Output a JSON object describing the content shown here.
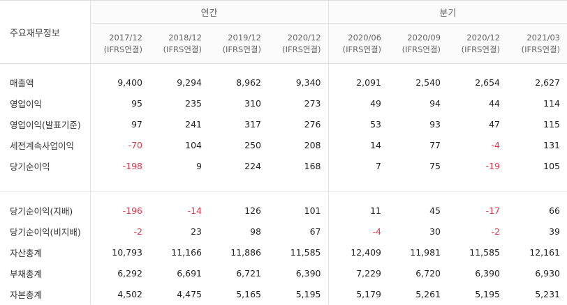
{
  "header": {
    "section_label": "주요재무정보",
    "annual_label": "연간",
    "quarterly_label": "분기",
    "periods": [
      {
        "date": "2017/12",
        "basis": "(IFRS연결)"
      },
      {
        "date": "2018/12",
        "basis": "(IFRS연결)"
      },
      {
        "date": "2019/12",
        "basis": "(IFRS연결)"
      },
      {
        "date": "2020/12",
        "basis": "(IFRS연결)"
      },
      {
        "date": "2020/06",
        "basis": "(IFRS연결)"
      },
      {
        "date": "2020/09",
        "basis": "(IFRS연결)"
      },
      {
        "date": "2020/12",
        "basis": "(IFRS연결)"
      },
      {
        "date": "2021/03",
        "basis": "(IFRS연결)"
      }
    ]
  },
  "rows": [
    {
      "label": "매출액",
      "values": [
        "9,400",
        "9,294",
        "8,962",
        "9,340",
        "2,091",
        "2,540",
        "2,654",
        "2,627"
      ]
    },
    {
      "label": "영업이익",
      "values": [
        "95",
        "235",
        "310",
        "273",
        "49",
        "94",
        "44",
        "114"
      ]
    },
    {
      "label": "영업이익(발표기준)",
      "values": [
        "97",
        "241",
        "317",
        "276",
        "53",
        "93",
        "47",
        "115"
      ]
    },
    {
      "label": "세전계속사업이익",
      "values": [
        "-70",
        "104",
        "250",
        "208",
        "14",
        "77",
        "-4",
        "131"
      ]
    },
    {
      "label": "당기순이익",
      "values": [
        "-198",
        "9",
        "224",
        "168",
        "7",
        "75",
        "-19",
        "105"
      ]
    },
    {
      "label": "당기순이익(지배)",
      "values": [
        "-196",
        "-14",
        "126",
        "101",
        "11",
        "45",
        "-17",
        "66"
      ]
    },
    {
      "label": "당기순이익(비지배)",
      "values": [
        "-2",
        "23",
        "98",
        "67",
        "-4",
        "30",
        "-2",
        "39"
      ]
    },
    {
      "label": "자산총계",
      "values": [
        "10,793",
        "11,166",
        "11,886",
        "11,585",
        "12,409",
        "11,981",
        "11,585",
        "12,161"
      ]
    },
    {
      "label": "부채총계",
      "values": [
        "6,292",
        "6,691",
        "6,721",
        "6,390",
        "7,229",
        "6,720",
        "6,390",
        "6,930"
      ]
    },
    {
      "label": "자본총계",
      "values": [
        "4,502",
        "4,475",
        "5,165",
        "5,195",
        "5,179",
        "5,261",
        "5,195",
        "5,231"
      ]
    }
  ],
  "colors": {
    "negative": "#e0384b",
    "border": "#e3e3e3",
    "header_bg": "#fafafa"
  }
}
